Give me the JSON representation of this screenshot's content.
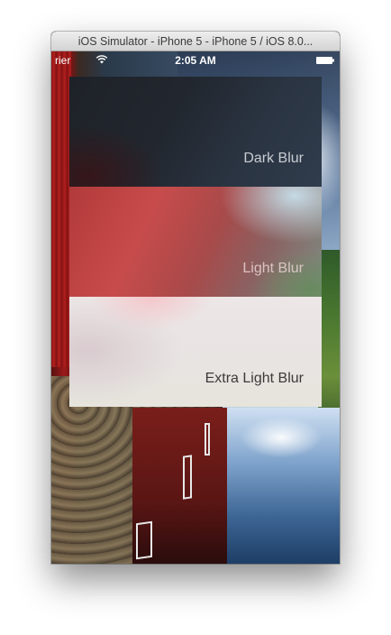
{
  "window": {
    "title": "iOS Simulator - iPhone 5 - iPhone 5 / iOS 8.0..."
  },
  "statusbar": {
    "carrier": "rier",
    "time": "2:05 AM",
    "icons": [
      "wifi-icon",
      "battery-icon"
    ],
    "text_color": "#ffffff"
  },
  "panels": [
    {
      "label": "Dark Blur",
      "style": "dark",
      "color": "#262c35"
    },
    {
      "label": "Light Blur",
      "style": "light",
      "color": "#b84444"
    },
    {
      "label": "Extra Light Blur",
      "style": "extra-light",
      "color": "#e8e4e2"
    }
  ]
}
